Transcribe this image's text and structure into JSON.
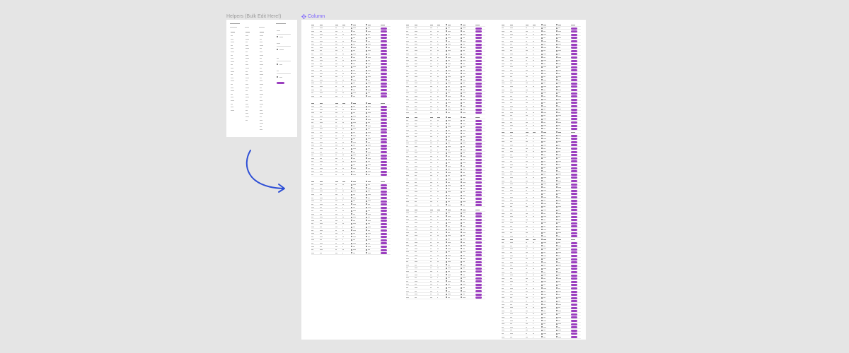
{
  "canvas": {
    "background": "#e5e5e5"
  },
  "frames": {
    "helpers": {
      "label": "Helpers (Bulk Edit Here!)",
      "label_color": "#9b9b9b"
    },
    "column": {
      "label": "Column",
      "label_color": "#7b61ff",
      "icon": "component-icon"
    }
  },
  "colors": {
    "accent_button": "#9b3fbf",
    "arrow": "#2e4fd6",
    "frame_bg": "#ffffff"
  },
  "arrow": {
    "icon": "curved-arrow-icon"
  }
}
